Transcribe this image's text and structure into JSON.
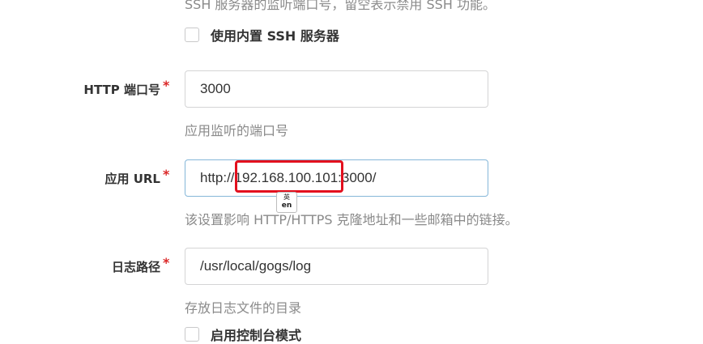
{
  "ssh_help": "SSH 服务器的监听端口号，留空表示禁用 SSH 功能。",
  "builtin_ssh": {
    "label": "使用内置 SSH 服务器",
    "checked": false
  },
  "http_port": {
    "label": "HTTP 端口号",
    "required_mark": "*",
    "value": "3000",
    "help": "应用监听的端口号"
  },
  "app_url": {
    "label": "应用 URL",
    "required_mark": "*",
    "value_prefix": "http://",
    "value_host": "192.168.100.101",
    "value_suffix": ":3000/",
    "help": "该设置影响 HTTP/HTTPS 克隆地址和一些邮箱中的链接。"
  },
  "log_path": {
    "label": "日志路径",
    "required_mark": "*",
    "value": "/usr/local/gogs/log",
    "help": "存放日志文件的目录"
  },
  "console_mode": {
    "label": "启用控制台模式",
    "checked": false
  },
  "ime_indicator": {
    "top": "英",
    "bottom": "en"
  },
  "colors": {
    "required": "#db2828",
    "highlight_box": "#e3101e",
    "focus_border": "#85b7d9"
  }
}
